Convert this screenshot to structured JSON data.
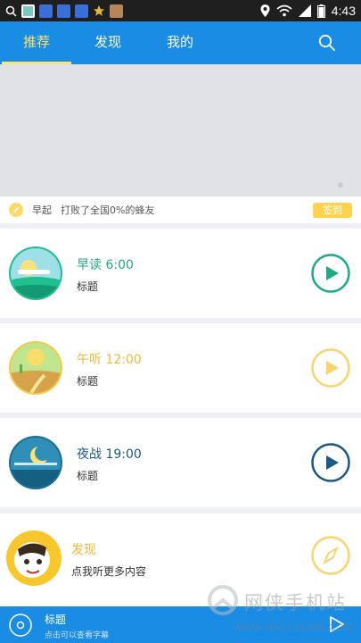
{
  "status_bar": {
    "time": "4:43",
    "icons": [
      "search-icon",
      "app-icon",
      "paw-icon",
      "paw-icon",
      "paw-icon",
      "star-icon",
      "avatar-icon"
    ]
  },
  "header": {
    "tabs": [
      {
        "label": "推荐",
        "active": true
      },
      {
        "label": "发现",
        "active": false
      },
      {
        "label": "我的",
        "active": false
      }
    ],
    "search_icon": "search-icon",
    "colors": {
      "bar": "#1a8ce3",
      "active_tab": "#ffe36b"
    }
  },
  "checkin": {
    "label": "早起",
    "stat_text": "打败了全国0%的蜂友",
    "button_label": "签到"
  },
  "sessions": [
    {
      "title": "早读 6:00",
      "subtitle": "标题",
      "color": "#21a885",
      "icon": "play-icon"
    },
    {
      "title": "午听 12:00",
      "subtitle": "标题",
      "color": "#f5b836",
      "icon": "play-icon"
    },
    {
      "title": "夜战 19:00",
      "subtitle": "标题",
      "color": "#1c5a83",
      "icon": "play-icon"
    }
  ],
  "discover": {
    "title": "发现",
    "subtitle": "点我听更多内容",
    "color": "#f5b836",
    "icon": "compass-icon"
  },
  "player": {
    "title": "标题",
    "hint": "点击可以查看字幕",
    "icon": "play-icon"
  },
  "watermark": {
    "text": "网侠手机站",
    "url_text": "WWW.HACKHOME.COM"
  }
}
